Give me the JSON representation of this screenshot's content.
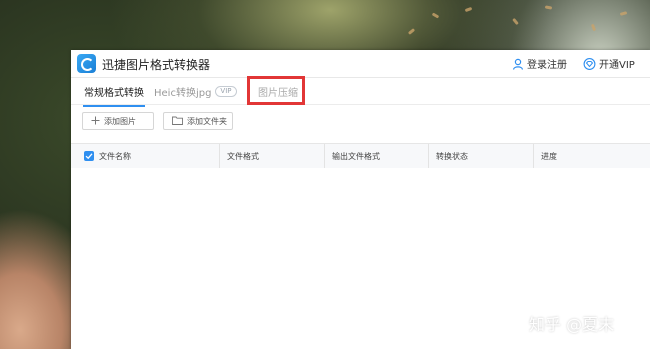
{
  "app": {
    "title": "迅捷图片格式转换器",
    "logo_icon": "app-logo-icon",
    "accent_color": "#2f8ff0"
  },
  "titlebar": {
    "login_label": "登录注册",
    "login_icon": "user-icon",
    "vip_label": "开通VIP",
    "vip_icon": "diamond-icon"
  },
  "tabs": {
    "normal": "常规格式转换",
    "heic": "Heic转换jpg",
    "heic_badge": "VIP",
    "compress": "图片压缩",
    "active": "常规格式转换",
    "highlighted": "图片压缩",
    "highlight_color": "#e23636"
  },
  "toolbar": {
    "add_image_label": "添加图片",
    "add_image_icon": "plus-icon",
    "add_folder_label": "添加文件夹",
    "add_folder_icon": "folder-icon"
  },
  "table": {
    "columns": [
      "文件名称",
      "文件格式",
      "输出文件格式",
      "转换状态",
      "进度"
    ],
    "select_all_checked": true,
    "rows": []
  },
  "watermark": "知乎 @夏末"
}
